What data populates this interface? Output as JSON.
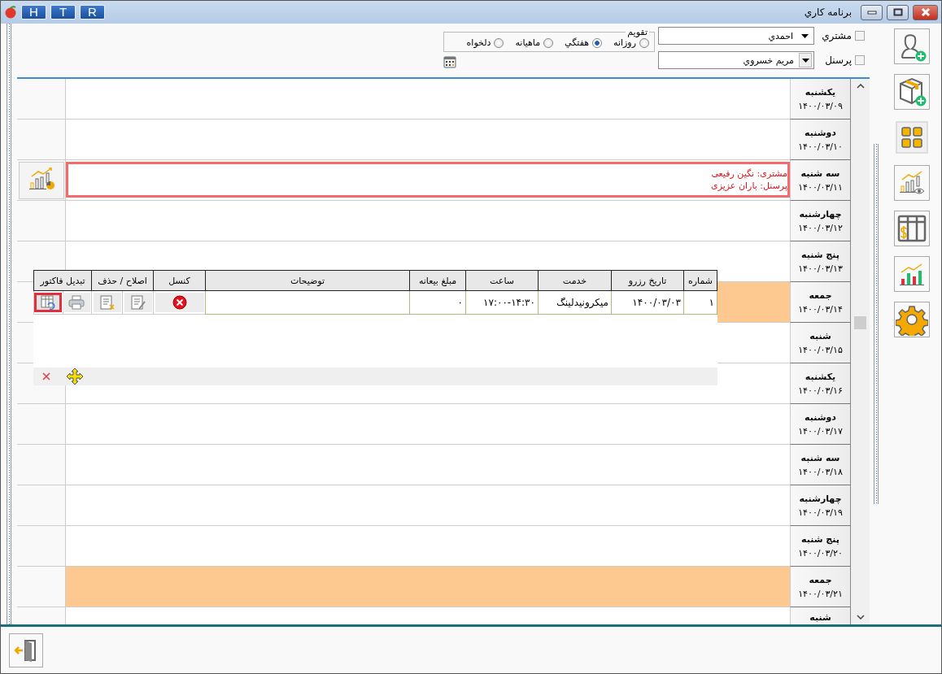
{
  "window": {
    "title": "برنامه کاري",
    "quick_buttons": [
      "R",
      "T",
      "H"
    ]
  },
  "filters": {
    "customer": {
      "label": "مشتري",
      "checked": false,
      "value": "احمدي"
    },
    "staff": {
      "label": "پرسنل",
      "checked": false,
      "value": "مريم خسروي"
    },
    "view": {
      "legend": "تقويم",
      "options": [
        {
          "label": "روزانه",
          "selected": false
        },
        {
          "label": "هفتگي",
          "selected": true
        },
        {
          "label": "ماهيانه",
          "selected": false
        },
        {
          "label": "دلخواه",
          "selected": false
        }
      ]
    }
  },
  "days": [
    {
      "name": "يكشنبه",
      "date": "۱۴۰۰/۰۳/۰۹",
      "holiday": false
    },
    {
      "name": "دوشنبه",
      "date": "۱۴۰۰/۰۳/۱۰",
      "holiday": false
    },
    {
      "name": "سه شنبه",
      "date": "۱۴۰۰/۰۳/۱۱",
      "holiday": false,
      "appointment": {
        "lines": [
          "مشتری: نگین رفیعی",
          "پرسنل: باران عزیزی"
        ]
      }
    },
    {
      "name": "چهارشنبه",
      "date": "۱۴۰۰/۰۳/۱۲",
      "holiday": false
    },
    {
      "name": "پنج شنبه",
      "date": "۱۴۰۰/۰۳/۱۳",
      "holiday": false
    },
    {
      "name": "جمعه",
      "date": "۱۴۰۰/۰۳/۱۴",
      "holiday": true
    },
    {
      "name": "شنبه",
      "date": "۱۴۰۰/۰۳/۱۵",
      "holiday": false
    },
    {
      "name": "يكشنبه",
      "date": "۱۴۰۰/۰۳/۱۶",
      "holiday": false
    },
    {
      "name": "دوشنبه",
      "date": "۱۴۰۰/۰۳/۱۷",
      "holiday": false
    },
    {
      "name": "سه شنبه",
      "date": "۱۴۰۰/۰۳/۱۸",
      "holiday": false
    },
    {
      "name": "چهارشنبه",
      "date": "۱۴۰۰/۰۳/۱۹",
      "holiday": false
    },
    {
      "name": "پنج شنبه",
      "date": "۱۴۰۰/۰۳/۲۰",
      "holiday": false
    },
    {
      "name": "جمعه",
      "date": "۱۴۰۰/۰۳/۲۱",
      "holiday": true
    },
    {
      "name": "شنبه",
      "holiday": false
    }
  ],
  "popup": {
    "columns": [
      "شماره",
      "تاریخ رزرو",
      "خدمت",
      "ساعت",
      "مبلغ بیعانه",
      "توضیحات",
      "کنسل",
      "اصلاح / حذف",
      "تبدیل فاکتور"
    ],
    "row": [
      "۱",
      "۱۴۰۰/۰۳/۰۳",
      "میکرونیدلینگ",
      "۱۷:۰۰-۱۴:۳۰",
      "۰"
    ],
    "actions": [
      {
        "kind": "cancel",
        "focused": false
      },
      {
        "kind": "edit",
        "focused": false
      },
      {
        "kind": "delete",
        "focused": false
      },
      {
        "kind": "print",
        "focused": false
      },
      {
        "kind": "convert",
        "focused": true
      }
    ]
  },
  "toolbar": [
    {
      "kind": "user-add",
      "selected": false
    },
    {
      "kind": "package-add",
      "selected": false
    },
    {
      "kind": "grid",
      "selected": true
    },
    {
      "kind": "chart-eye",
      "selected": false
    },
    {
      "kind": "table-dollar",
      "selected": false
    },
    {
      "kind": "bar-chart",
      "selected": false
    },
    {
      "kind": "gear",
      "selected": false
    }
  ]
}
